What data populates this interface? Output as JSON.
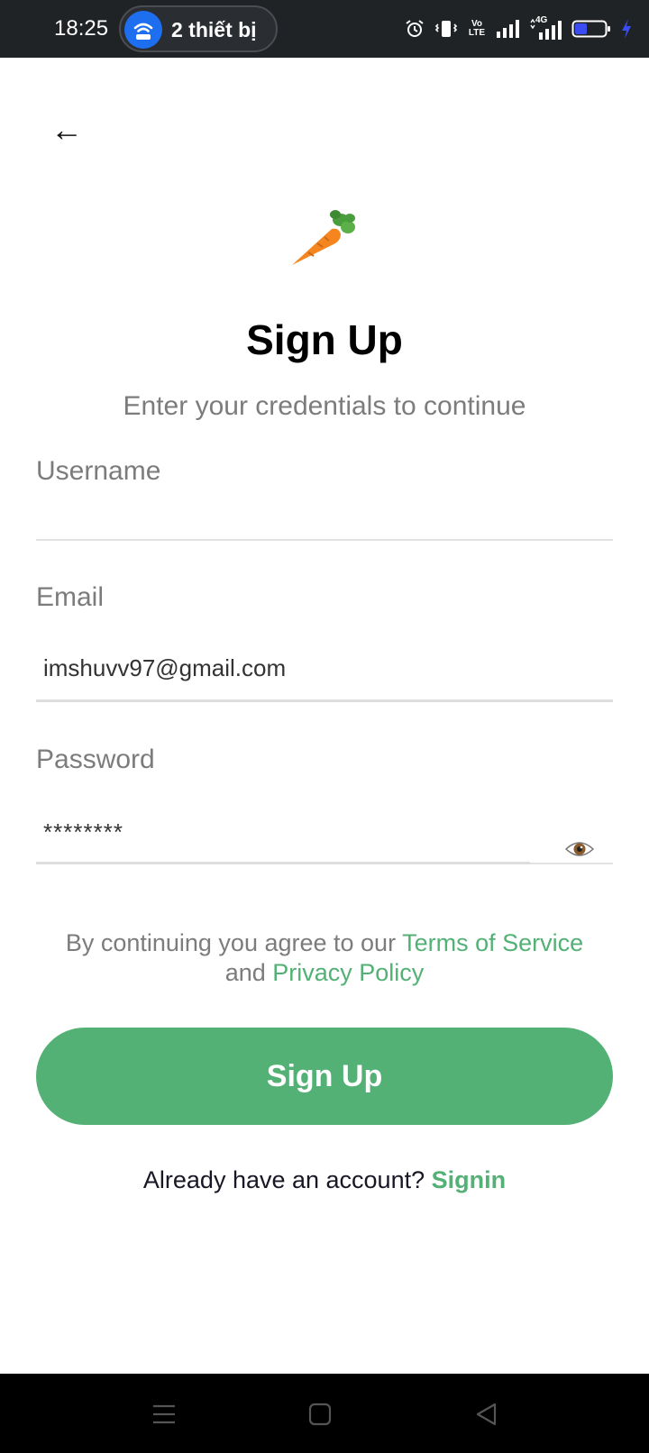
{
  "status_bar": {
    "time": "18:25",
    "hotspot_label": "2 thiết bị",
    "icons": [
      "alarm-icon",
      "vibrate-icon",
      "volte-icon",
      "signal-icon",
      "signal-4g-icon",
      "battery-icon",
      "charging-icon"
    ],
    "volte_text": "Vo LTE",
    "network_text": "4G"
  },
  "header": {
    "back_symbol": "←"
  },
  "logo": {
    "icon": "carrot-icon"
  },
  "page": {
    "title": "Sign Up",
    "subtitle": "Enter your credentials to continue"
  },
  "form": {
    "username": {
      "label": "Username",
      "value": ""
    },
    "email": {
      "label": "Email",
      "value": "imshuvv97@gmail.com"
    },
    "password": {
      "label": "Password",
      "value": "********",
      "toggle_icon": "eye-icon"
    }
  },
  "terms": {
    "prefix": "By continuing you agree to our ",
    "terms_link": "Terms of Service",
    "middle": " and ",
    "privacy_link": "Privacy Policy"
  },
  "signup_button": {
    "label": "Sign Up"
  },
  "signin": {
    "prompt": "Already have an account? ",
    "link": "Signin"
  },
  "colors": {
    "accent": "#53b175",
    "status_bar": "#202326",
    "hotspot_blue": "#1e6ef0",
    "battery_blue": "#3a4cf2"
  },
  "nav_bar": {
    "icons": [
      "menu-icon",
      "home-icon",
      "back-icon"
    ]
  }
}
